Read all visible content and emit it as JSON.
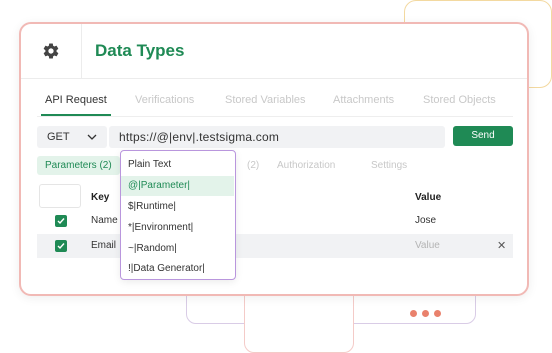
{
  "header": {
    "title": "Data Types",
    "icon": "gear-icon"
  },
  "tabs": [
    {
      "label": "API Request",
      "active": true
    },
    {
      "label": "Verifications",
      "active": false
    },
    {
      "label": "Stored Variables",
      "active": false
    },
    {
      "label": "Attachments",
      "active": false
    },
    {
      "label": "Stored Objects",
      "active": false
    }
  ],
  "request": {
    "method": "GET",
    "url": "https://@|env|.testsigma.com",
    "send_label": "Send"
  },
  "subtabs": [
    {
      "label": "Parameters (2)",
      "active": true
    },
    {
      "label": "(2)",
      "active": false
    },
    {
      "label": "Authorization",
      "active": false
    },
    {
      "label": "Settings",
      "active": false
    }
  ],
  "table": {
    "headers": {
      "key": "Key",
      "value": "Value"
    },
    "rows": [
      {
        "checked": true,
        "key": "Name",
        "value": "Jose"
      },
      {
        "checked": true,
        "key": "Email",
        "value": "",
        "value_placeholder": "Value"
      }
    ]
  },
  "dropdown": {
    "items": [
      {
        "label": "Plain Text",
        "highlighted": false
      },
      {
        "label": "@|Parameter|",
        "highlighted": true
      },
      {
        "label": "$|Runtime|",
        "highlighted": false
      },
      {
        "label": "*|Environment|",
        "highlighted": false
      },
      {
        "label": "~|Random|",
        "highlighted": false
      },
      {
        "label": "!|Data Generator|",
        "highlighted": false
      }
    ]
  },
  "colors": {
    "accent": "#1f8a55",
    "dropdown_border": "#b996dd",
    "card_border": "#f1b9b5"
  }
}
